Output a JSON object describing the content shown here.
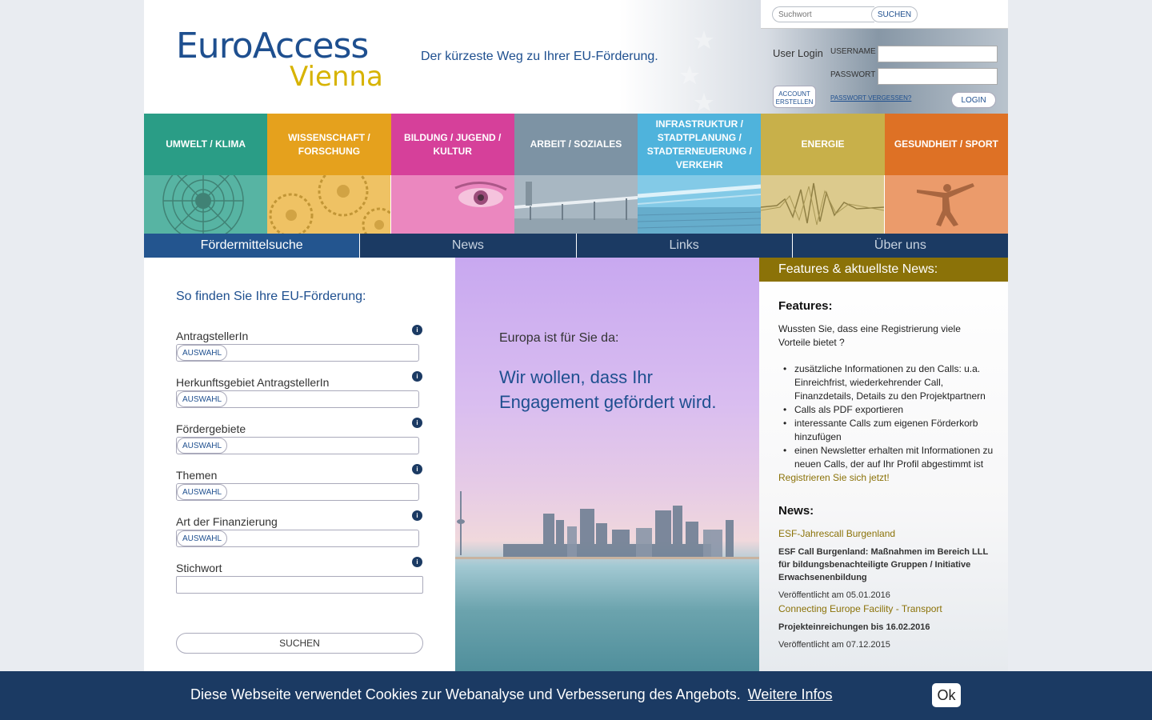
{
  "header": {
    "logo_top": "EuroAccess",
    "logo_bottom": "Vienna",
    "tagline": "Der kürzeste Weg zu Ihrer EU-Förderung."
  },
  "search": {
    "placeholder": "Suchwort",
    "button": "SUCHEN"
  },
  "login": {
    "title": "User Login",
    "username_label": "USERNAME",
    "password_label": "PASSWORT",
    "create_account": "ACCOUNT ERSTELLEN",
    "forgot": "PASSWORT VERGESSEN?",
    "login_button": "LOGIN"
  },
  "categories": [
    {
      "label": "UMWELT / KLIMA",
      "color": "#2a9d86"
    },
    {
      "label": "WISSENSCHAFT / FORSCHUNG",
      "color": "#e5a11d"
    },
    {
      "label": "BILDUNG / JUGEND / KULTUR",
      "color": "#d6409a"
    },
    {
      "label": "ARBEIT / SOZIALES",
      "color": "#7d93a4"
    },
    {
      "label": "INFRASTRUKTUR / STADTPLANUNG / STADTERNEUERUNG / VERKEHR",
      "color": "#4fb3dc"
    },
    {
      "label": "ENERGIE",
      "color": "#c8b04a"
    },
    {
      "label": "GESUNDHEIT / SPORT",
      "color": "#de7125"
    }
  ],
  "nav": [
    {
      "label": "Fördermittelsuche"
    },
    {
      "label": "News"
    },
    {
      "label": "Links"
    },
    {
      "label": "Über uns"
    }
  ],
  "form": {
    "title": "So finden Sie Ihre EU-Förderung:",
    "select_button": "AUSWAHL",
    "info_glyph": "i",
    "fields": [
      {
        "label": "AntragstellerIn"
      },
      {
        "label": "Herkunftsgebiet AntragstellerIn"
      },
      {
        "label": "Fördergebiete"
      },
      {
        "label": "Themen"
      },
      {
        "label": "Art der Finanzierung"
      },
      {
        "label": "Stichwort"
      }
    ],
    "submit": "SUCHEN"
  },
  "hero": {
    "intro": "Europa ist für Sie da:",
    "headline": "Wir wollen, dass Ihr Engagement gefördert wird."
  },
  "sidebar": {
    "header": "Features & aktuellste News:",
    "features_title": "Features:",
    "features_intro": "Wussten Sie, dass eine Registrierung viele Vorteile bietet ?",
    "features_list": [
      "zusätzliche Informationen zu den Calls: u.a. Einreichfrist, wiederkehrender Call, Finanzdetails, Details zu den Projektpartnern",
      "Calls als PDF exportieren",
      "interessante Calls zum eigenen Förderkorb hinzufügen",
      "einen Newsletter erhalten mit Informationen zu neuen Calls, der auf Ihr Profil abgestimmt ist"
    ],
    "register_link": "Registrieren Sie sich jetzt!",
    "news_title": "News:",
    "news": [
      {
        "title": "ESF-Jahrescall Burgenland",
        "desc": "ESF Call Burgenland: Maßnahmen im Bereich LLL für bildungsbenachteiligte Gruppen / Initiative Erwachsenenbildung",
        "date": "Veröffentlicht am 05.01.2016"
      },
      {
        "title": "Connecting Europe Facility - Transport",
        "desc": "Projekteinreichungen bis 16.02.2016",
        "date": "Veröffentlicht am 07.12.2015"
      }
    ]
  },
  "cookie": {
    "text": "Diese Webseite verwendet Cookies zur Webanalyse und Verbesserung des Angebots.",
    "link": "Weitere Infos",
    "ok": "Ok"
  }
}
